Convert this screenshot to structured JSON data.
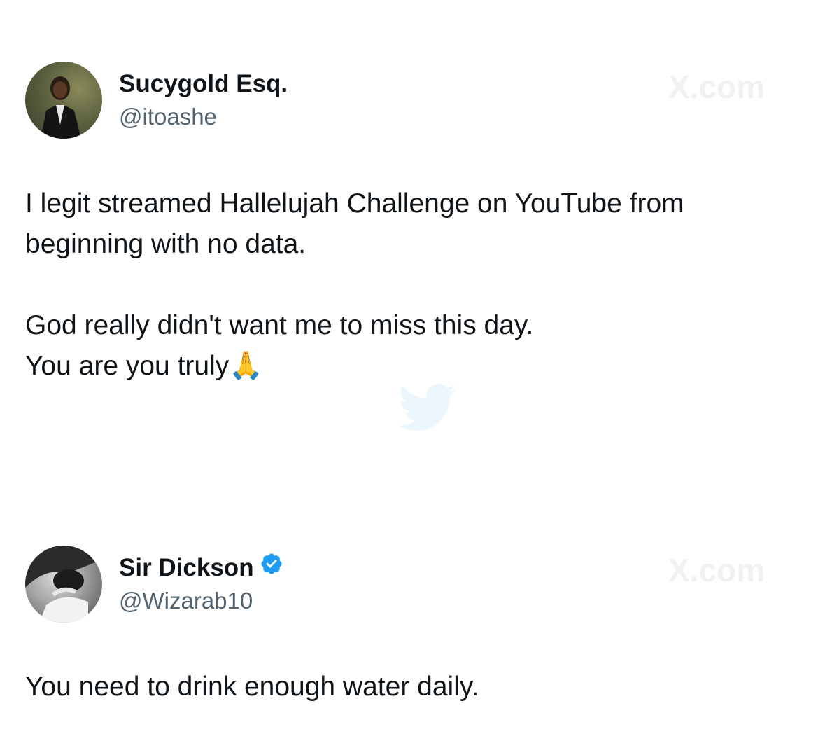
{
  "tweets": [
    {
      "display_name": "Sucygold Esq.",
      "handle": "@itoashe",
      "verified": false,
      "watermark": "X.com",
      "lines": [
        "I legit streamed Hallelujah Challenge on YouTube from",
        "beginning with no data.",
        "",
        "God really didn't want me to miss this day.",
        "You are you truly🙏"
      ]
    },
    {
      "display_name": "Sir Dickson",
      "handle": "@Wizarab10",
      "verified": true,
      "watermark": "X.com",
      "lines": [
        "You need to drink enough water daily."
      ]
    }
  ],
  "icons": {
    "verified": "verified-badge-icon",
    "bird": "bird-icon"
  },
  "colors": {
    "text": "#0f1419",
    "secondary": "#536471",
    "verified": "#1d9bf0"
  }
}
